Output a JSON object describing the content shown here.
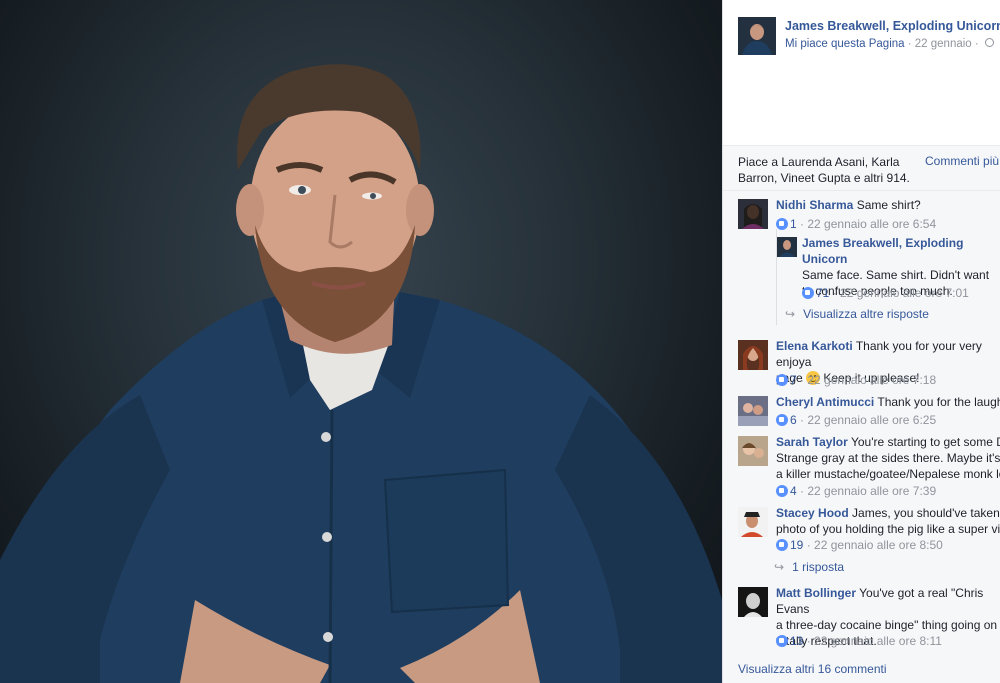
{
  "post": {
    "page_name": "James Breakwell, Exploding Unicorn",
    "like_page": "Mi piace questa Pagina",
    "date": " · 22 gennaio · "
  },
  "reactions": {
    "summary": "Piace a Laurenda Asani, Karla Barron, Vineet Gupta e altri 914.",
    "more_comments_link": "Commenti più r"
  },
  "comments": [
    {
      "author": "Nidhi Sharma",
      "text": "Same shirt?",
      "likes": "1",
      "time": "· 22 gennaio alle ore 6:54"
    },
    {
      "author": "James Breakwell, Exploding Unicorn",
      "text": "Same face. Same shirt. Didn't want to confuse people too much.",
      "likes": "71",
      "time": "· 22 gennaio alle ore 7:01"
    },
    {
      "author": "Elena Karkoti",
      "text": "Thank you for your very enjoya",
      "text2": "page",
      "text3": " Keep it up please!",
      "likes": "7",
      "time": "· 22 gennaio alle ore 7:18"
    },
    {
      "author": "Cheryl Antimucci",
      "text": "Thank you for the laughs!",
      "likes": "6",
      "time": "· 22 gennaio alle ore 6:25"
    },
    {
      "author": "Sarah Taylor",
      "text": "You're starting to get some Do",
      "text2": "Strange gray at the sides there. Maybe it's ti",
      "text3": "a killer mustache/goatee/Nepalese monk loo",
      "likes": "4",
      "time": "· 22 gennaio alle ore 7:39"
    },
    {
      "author": "Stacey Hood",
      "text": "James, you should've taken th",
      "text2": "photo of you holding the pig like a super villa",
      "likes": "19",
      "time": "· 22 gennaio alle ore 8:50"
    },
    {
      "author": "Matt Bollinger",
      "text": "You've got a real \"Chris Evans",
      "text2": "a three-day cocaine binge\" thing going on ar",
      "text3": "totally respect that.",
      "likes": "13",
      "time": "· 22 gennaio alle ore 8:11"
    }
  ],
  "links": {
    "more_replies": "Visualizza altre risposte",
    "one_reply": "1 risposta",
    "view_more_comments": "Visualizza altri 16 commenti"
  },
  "colors": {
    "link": "#365899",
    "meta": "#90949c",
    "panel_bg": "#f6f7f9",
    "shirt": "#1f3d5e"
  }
}
